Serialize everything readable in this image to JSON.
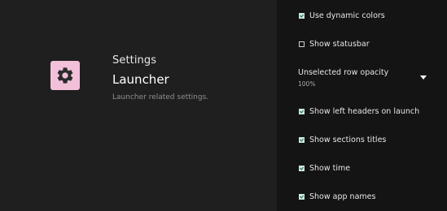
{
  "header": {
    "breadcrumb": "Settings",
    "title": "Launcher",
    "description": "Launcher related settings."
  },
  "settings": {
    "dynamic_colors": {
      "label": "Use dynamic colors",
      "checked": true
    },
    "statusbar": {
      "label": "Show statusbar",
      "checked": false
    },
    "row_opacity": {
      "label": "Unselected row opacity",
      "value": "100%"
    },
    "left_headers": {
      "label": "Show left headers on launch",
      "checked": true
    },
    "section_titles": {
      "label": "Show sections titles",
      "checked": true
    },
    "time": {
      "label": "Show time",
      "checked": true
    },
    "app_names": {
      "label": "Show app names",
      "checked": true
    }
  },
  "colors": {
    "icon_background": "#f2c0d8",
    "checkbox_checked": "#c9eadf"
  },
  "icons": {
    "app_icon": "gear-icon",
    "dropdown": "caret-down-icon"
  }
}
